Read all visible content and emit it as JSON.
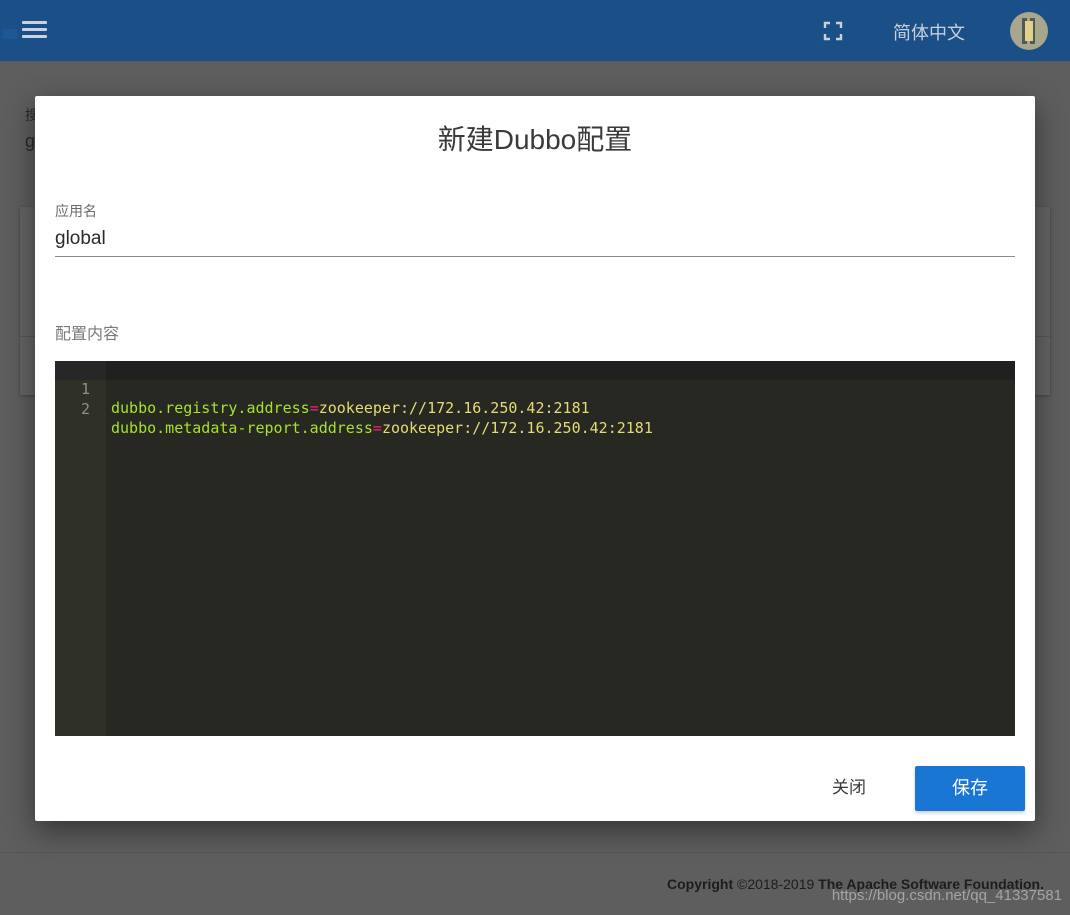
{
  "header": {
    "language_label": "简体中文",
    "icons": [
      "menu-icon",
      "fullscreen-icon",
      "avatar"
    ]
  },
  "background_page": {
    "field_label_fragment": "搜",
    "field_value_fragment": "g",
    "footer": {
      "copyright_label": "Copyright",
      "years": "©2018-2019",
      "organization": "The Apache Software Foundation."
    },
    "watermark": "https://blog.csdn.net/qq_41337581"
  },
  "dialog": {
    "title": "新建Dubbo配置",
    "app_name_label": "应用名",
    "app_name_value": "global",
    "content_label": "配置内容",
    "editor": {
      "lines": [
        {
          "number": "1",
          "key": "dubbo.registry.address",
          "op": "=",
          "value": "zookeeper://172.16.250.42:2181"
        },
        {
          "number": "2",
          "key": "dubbo.metadata-report.address",
          "op": "=",
          "value": "zookeeper://172.16.250.42:2181"
        }
      ]
    },
    "close_label": "关闭",
    "save_label": "保存"
  },
  "colors": {
    "app_bar": "#1b4f88",
    "primary_button": "#1976d2",
    "editor_background": "#272822",
    "editor_key": "#a6e22e",
    "editor_operator": "#f92672",
    "editor_value": "#e6db74"
  }
}
